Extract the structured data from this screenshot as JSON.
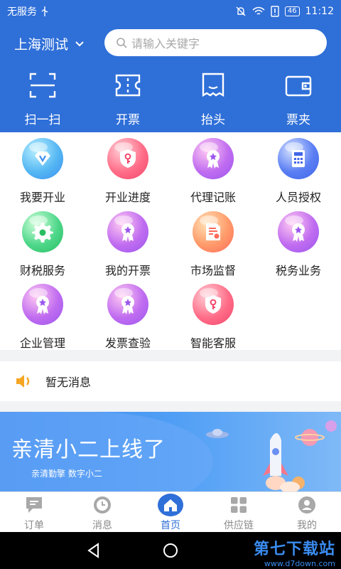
{
  "status_bar": {
    "carrier": "无服务",
    "battery": "46",
    "time": "11:12"
  },
  "header": {
    "city": "上海测试",
    "search_placeholder": "请输入关键字"
  },
  "quick_actions": [
    {
      "label": "扫一扫",
      "icon": "scan-icon"
    },
    {
      "label": "开票",
      "icon": "ticket-icon"
    },
    {
      "label": "抬头",
      "icon": "receipt-icon"
    },
    {
      "label": "票夹",
      "icon": "wallet-icon"
    }
  ],
  "services": [
    {
      "label": "我要开业",
      "icon": "diamond-icon",
      "color": "#3b8ff0"
    },
    {
      "label": "开业进度",
      "icon": "shield-key-icon",
      "color": "#f3456a"
    },
    {
      "label": "代理记账",
      "icon": "badge-star-icon",
      "color": "#9b56ee"
    },
    {
      "label": "人员授权",
      "icon": "calculator-icon",
      "color": "#4166e8"
    },
    {
      "label": "财税服务",
      "icon": "gear-icon",
      "color": "#29be62"
    },
    {
      "label": "我的开票",
      "icon": "badge-star-icon",
      "color": "#9b56ee"
    },
    {
      "label": "市场监督",
      "icon": "document-icon",
      "color": "#ff6a5a"
    },
    {
      "label": "税务业务",
      "icon": "badge-star-icon",
      "color": "#9b56ee"
    },
    {
      "label": "企业管理",
      "icon": "badge-star-icon",
      "color": "#9b56ee"
    },
    {
      "label": "发票查验",
      "icon": "badge-star-icon",
      "color": "#9b56ee"
    },
    {
      "label": "智能客服",
      "icon": "shield-key-icon",
      "color": "#f3456a"
    }
  ],
  "notice": {
    "text": "暂无消息",
    "icon": "speaker-icon"
  },
  "banner": {
    "title": "亲清小二上线了",
    "subtitle": "亲清勤擎  数字小二"
  },
  "tabs": [
    {
      "label": "订单",
      "icon": "chat-icon",
      "active": false
    },
    {
      "label": "消息",
      "icon": "clock-icon",
      "active": false
    },
    {
      "label": "首页",
      "icon": "home-icon",
      "active": true
    },
    {
      "label": "供应链",
      "icon": "grid-icon",
      "active": false
    },
    {
      "label": "我的",
      "icon": "user-icon",
      "active": false
    }
  ],
  "watermark": {
    "main": "第七下载站",
    "sub": "www.d7down.com"
  },
  "colors": {
    "primary": "#2f6fd8",
    "background": "#f2f3f5"
  }
}
